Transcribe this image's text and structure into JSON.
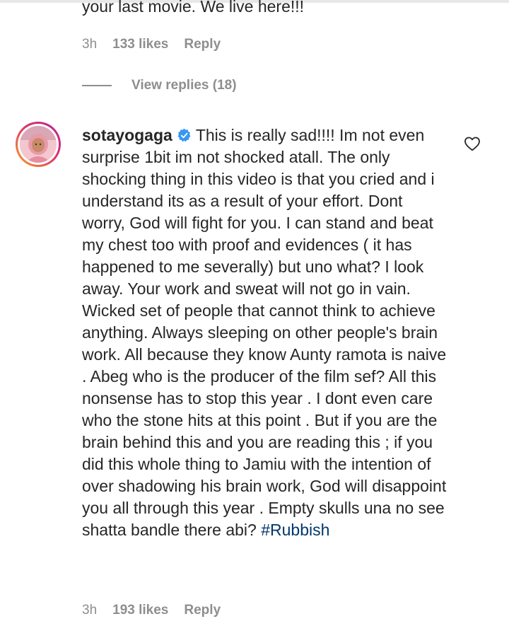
{
  "previous_comment": {
    "text_tail": "your last movie. We live here!!!",
    "time": "3h",
    "likes": "133 likes",
    "reply_label": "Reply",
    "view_replies_label": "View replies (18)"
  },
  "comment": {
    "username": "sotayogaga",
    "verified": true,
    "text": "This is really sad!!!! Im not even surprise 1bit im not shocked atall. The only shocking thing in this video is that you cried and i understand its as a result of your effort. Dont worry, God will fight for you. I can stand and beat my chest too with proof and evidences ( it has happened to me severally) but uno what? I look away. Your work and sweat will not go in vain. Wicked set of people that cannot think to achieve anything. Always sleeping on other people's brain work. All because they know Aunty ramota is naive . Abeg who is the producer of the film sef? All this nonsense has to stop this year . I dont even care who the stone hits at this point . But if you are the brain behind this and you are reading this ; if you did this whole thing to Jamiu with the intention of over shadowing his brain work, God will disappoint you all through this year . Empty skulls una no see shatta bandle there abi?",
    "hashtag": "#Rubbish",
    "time": "3h",
    "likes": "193 likes",
    "reply_label": "Reply"
  },
  "icons": {
    "verified": "verified-badge-icon",
    "like": "heart-outline-icon"
  },
  "colors": {
    "text": "#262626",
    "meta": "#8e8e8e",
    "verified_blue": "#3897f0",
    "hashtag": "#00376b"
  }
}
